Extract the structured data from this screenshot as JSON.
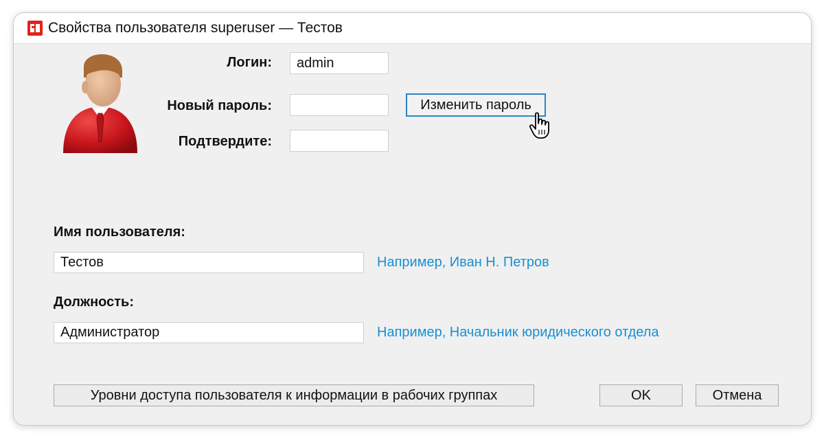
{
  "window": {
    "title": "Свойства пользователя superuser — Тестов",
    "app_icon": "app-logo-icon"
  },
  "avatar": {
    "icon": "user-avatar-icon",
    "colors": {
      "suit": "#c8161d",
      "skin": "#e0b090",
      "hair": "#a86a36"
    }
  },
  "login": {
    "label": "Логин:",
    "value": "admin"
  },
  "new_password": {
    "label": "Новый пароль:",
    "value": ""
  },
  "confirm_password": {
    "label": "Подтвердите:",
    "value": ""
  },
  "change_password_button": {
    "label": "Изменить пароль"
  },
  "user_name": {
    "label": "Имя пользователя:",
    "value": "Тестов",
    "hint": "Например, Иван Н. Петров"
  },
  "position": {
    "label": "Должность:",
    "value": "Администратор",
    "hint": "Например, Начальник юридического отдела"
  },
  "footer": {
    "access_levels_button": "Уровни доступа пользователя к информации в рабочих группах",
    "ok_button": "OK",
    "cancel_button": "Отмена"
  },
  "colors": {
    "hint": "#1a8fd0",
    "focus": "#2b84c6",
    "app_icon": "#e2231a"
  }
}
